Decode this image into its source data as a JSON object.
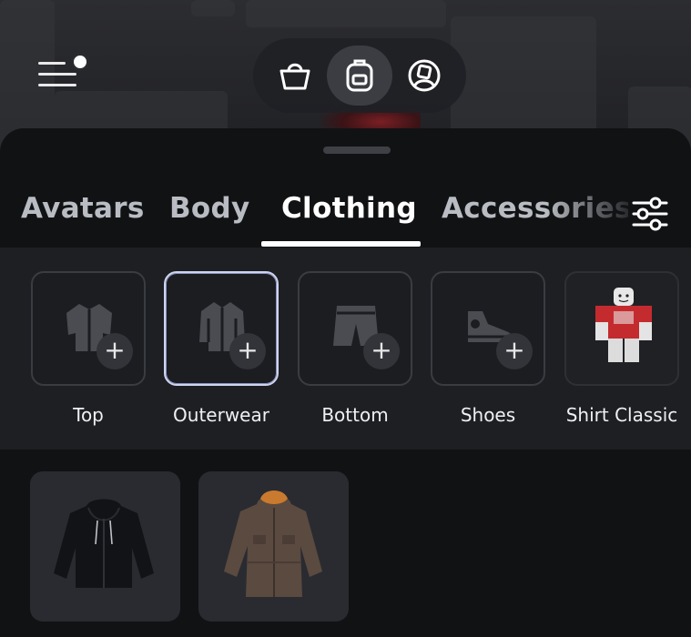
{
  "topnav": {
    "items": [
      {
        "icon": "shopping-bag-icon"
      },
      {
        "icon": "backpack-icon",
        "active": true
      },
      {
        "icon": "avatar-profile-icon"
      }
    ]
  },
  "menu": {
    "icon": "hamburger-menu-icon",
    "notification_dot": true
  },
  "tabs": {
    "items": [
      "Avatars",
      "Body",
      "Clothing",
      "Accessories"
    ],
    "active": "Clothing"
  },
  "filter": {
    "icon": "sliders-filter-icon"
  },
  "categories": [
    {
      "label": "Top",
      "icon": "shirt-icon",
      "add": "+"
    },
    {
      "label": "Outerwear",
      "icon": "jacket-icon",
      "add": "+",
      "selected": true
    },
    {
      "label": "Bottom",
      "icon": "shorts-icon",
      "add": "+"
    },
    {
      "label": "Shoes",
      "icon": "sneaker-icon",
      "add": "+"
    },
    {
      "label": "Shirt Classic",
      "icon": "avatar-shirt-thumbnail",
      "add": ""
    }
  ],
  "items": [
    {
      "name": "black-zip-hoodie"
    },
    {
      "name": "brown-parka"
    }
  ],
  "colors": {
    "accent": "#ffffff",
    "sheet_bg": "#111214",
    "card_bg": "#1c1d21",
    "selected_border": "#cfd4ee"
  }
}
